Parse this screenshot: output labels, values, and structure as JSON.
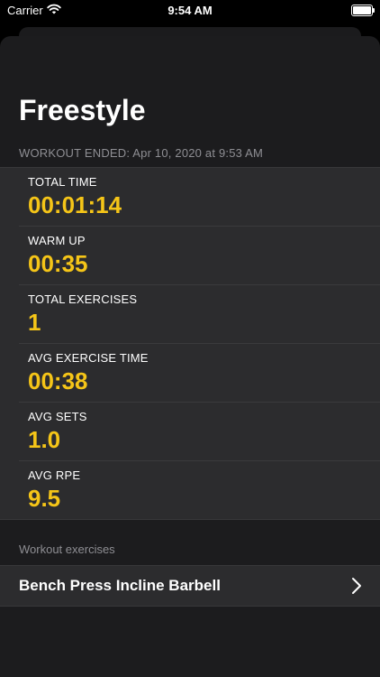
{
  "status_bar": {
    "carrier": "Carrier",
    "time": "9:54 AM",
    "battery_level_fraction": 1.0
  },
  "workout": {
    "title": "Freestyle",
    "ended": "WORKOUT ENDED: Apr 10, 2020 at 9:53 AM"
  },
  "stats": [
    {
      "label": "TOTAL TIME",
      "value": "00:01:14"
    },
    {
      "label": "WARM UP",
      "value": "00:35"
    },
    {
      "label": "TOTAL EXERCISES",
      "value": "1"
    },
    {
      "label": "AVG EXERCISE TIME",
      "value": "00:38"
    },
    {
      "label": "AVG SETS",
      "value": "1.0"
    },
    {
      "label": "AVG RPE",
      "value": "9.5"
    }
  ],
  "exercises_section": {
    "header": "Workout exercises",
    "items": [
      {
        "name": "Bench Press Incline Barbell"
      }
    ]
  },
  "colors": {
    "accent": "#f5c518",
    "sheet_background": "#1c1c1e",
    "cell_background": "#2c2c2e",
    "secondary_text": "#8e8e93"
  },
  "icons": {
    "wifi": "wifi-icon",
    "battery": "battery-icon",
    "chevron": "chevron-right-icon"
  }
}
